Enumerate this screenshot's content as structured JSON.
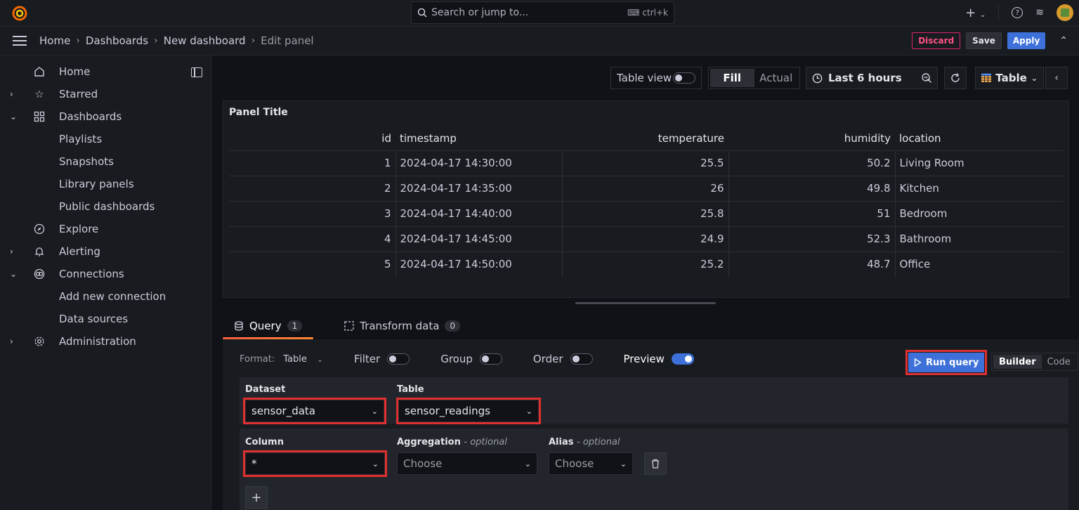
{
  "search": {
    "placeholder": "Search or jump to...",
    "shortcut": "ctrl+k"
  },
  "breadcrumb": [
    "Home",
    "Dashboards",
    "New dashboard",
    "Edit panel"
  ],
  "actions": {
    "discard": "Discard",
    "save": "Save",
    "apply": "Apply"
  },
  "sidebar": {
    "items": [
      {
        "label": "Home",
        "icon": "home-icon"
      },
      {
        "label": "Starred",
        "icon": "star-icon"
      },
      {
        "label": "Dashboards",
        "icon": "dashboards-icon"
      },
      {
        "label": "Playlists"
      },
      {
        "label": "Snapshots"
      },
      {
        "label": "Library panels"
      },
      {
        "label": "Public dashboards"
      },
      {
        "label": "Explore",
        "icon": "compass-icon"
      },
      {
        "label": "Alerting",
        "icon": "bell-icon"
      },
      {
        "label": "Connections",
        "icon": "connections-icon"
      },
      {
        "label": "Add new connection"
      },
      {
        "label": "Data sources"
      },
      {
        "label": "Administration",
        "icon": "gear-icon"
      }
    ]
  },
  "toolbar": {
    "table_view": "Table view",
    "fill": "Fill",
    "actual": "Actual",
    "time_range": "Last 6 hours",
    "viz": "Table"
  },
  "panel": {
    "title": "Panel Title",
    "columns": [
      "id",
      "timestamp",
      "temperature",
      "humidity",
      "location"
    ],
    "rows": [
      [
        "1",
        "2024-04-17 14:30:00",
        "25.5",
        "50.2",
        "Living Room"
      ],
      [
        "2",
        "2024-04-17 14:35:00",
        "26",
        "49.8",
        "Kitchen"
      ],
      [
        "3",
        "2024-04-17 14:40:00",
        "25.8",
        "51",
        "Bedroom"
      ],
      [
        "4",
        "2024-04-17 14:45:00",
        "24.9",
        "52.3",
        "Bathroom"
      ],
      [
        "5",
        "2024-04-17 14:50:00",
        "25.2",
        "48.7",
        "Office"
      ]
    ]
  },
  "tabs": [
    {
      "label": "Query",
      "count": "1"
    },
    {
      "label": "Transform data",
      "count": "0"
    }
  ],
  "query": {
    "format_label": "Format:",
    "format_value": "Table",
    "filter": "Filter",
    "group": "Group",
    "order": "Order",
    "preview": "Preview",
    "run": "Run query",
    "builder": "Builder",
    "code": "Code",
    "dataset_label": "Dataset",
    "dataset_value": "sensor_data",
    "table_label": "Table",
    "table_value": "sensor_readings",
    "column_label": "Column",
    "column_value": "*",
    "aggregation_label": "Aggregation",
    "aggregation_opt": "- optional",
    "aggregation_placeholder": "Choose",
    "alias_label": "Alias",
    "alias_opt": "- optional",
    "alias_placeholder": "Choose"
  }
}
